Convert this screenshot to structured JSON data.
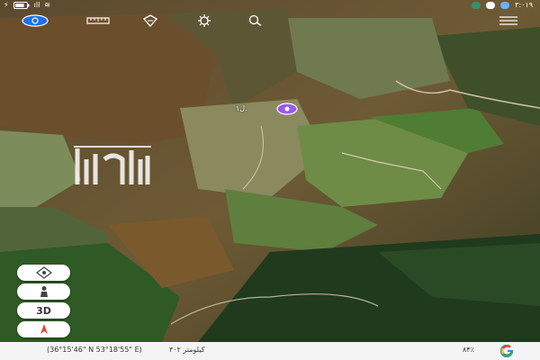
{
  "status_bar": {
    "time": "۳:۰۱۹",
    "battery_level": 0.8
  },
  "toolbar": {
    "icons": [
      "compass-icon",
      "ruler-icon",
      "layers-icon",
      "settings-icon",
      "search-icon",
      "menu-icon"
    ]
  },
  "map": {
    "place_label": "ل‌۱.",
    "marker_color": "#9b59f0",
    "watermark": "ملک"
  },
  "controls": {
    "three_d_label": "3D",
    "icons": [
      "location-target-icon",
      "person-icon",
      "3d-toggle",
      "compass-arrow-icon"
    ]
  },
  "bottom_bar": {
    "coordinates": "(36°15'46\" N 53°18'55\" E)",
    "altitude": "کیلومتر ۳۰۲",
    "zoom": "۸۴٪",
    "google_logo": "G"
  },
  "colors": {
    "accent": "#1a73e8",
    "marker": "#9b59f0",
    "bar_bg": "#f4f4f4"
  }
}
